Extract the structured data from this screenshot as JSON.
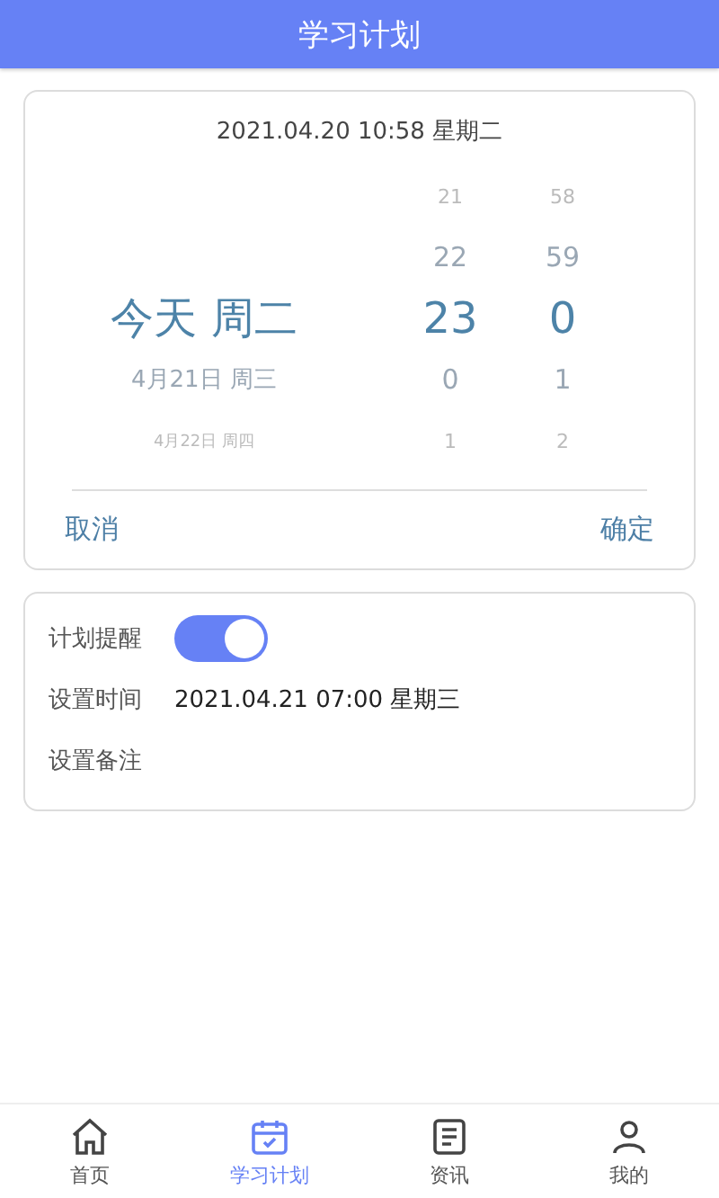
{
  "header": {
    "title": "学习计划"
  },
  "picker": {
    "current_time": "2021.04.20 10:58 星期二",
    "columns": [
      {
        "kind": "date",
        "items": [
          {
            "label": "今天 周二",
            "selected": true
          },
          {
            "label": "4月21日 周三",
            "selected": false
          },
          {
            "label": "4月22日 周四",
            "selected": false
          }
        ]
      },
      {
        "kind": "hour",
        "items": [
          {
            "label": "21",
            "selected": false
          },
          {
            "label": "22",
            "selected": false
          },
          {
            "label": "23",
            "selected": true
          },
          {
            "label": "0",
            "selected": false
          },
          {
            "label": "1",
            "selected": false
          }
        ]
      },
      {
        "kind": "minute",
        "items": [
          {
            "label": "58",
            "selected": false
          },
          {
            "label": "59",
            "selected": false
          },
          {
            "label": "0",
            "selected": true
          },
          {
            "label": "1",
            "selected": false
          },
          {
            "label": "2",
            "selected": false
          }
        ]
      }
    ],
    "cancel": "取消",
    "confirm": "确定"
  },
  "settings": [
    {
      "kind": "toggle",
      "label": "计划提醒",
      "on": true
    },
    {
      "kind": "value",
      "label": "设置时间",
      "value": "2021.04.21 07:00 星期三"
    },
    {
      "kind": "value",
      "label": "设置备注"
    }
  ],
  "tabbar": [
    {
      "label": "首页",
      "kind": "home",
      "selected": false
    },
    {
      "label": "学习计划",
      "kind": "calendar",
      "selected": true
    },
    {
      "label": "资讯",
      "kind": "news",
      "selected": false
    },
    {
      "label": "我的",
      "kind": "user",
      "selected": false
    }
  ]
}
